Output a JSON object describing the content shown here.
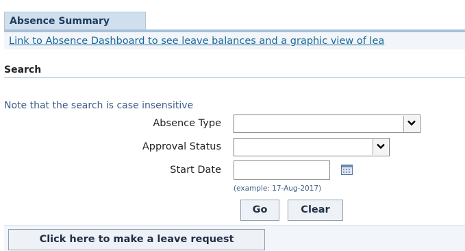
{
  "tab": {
    "label": "Absence Summary"
  },
  "dashboard_link": {
    "text": "Link to Absence Dashboard to see leave balances and a graphic view of lea"
  },
  "search": {
    "header": "Search",
    "note": "Note that the search is case insensitive",
    "fields": {
      "absence_type": {
        "label": "Absence Type",
        "value": ""
      },
      "approval_status": {
        "label": "Approval Status",
        "value": ""
      },
      "start_date": {
        "label": "Start Date",
        "value": "",
        "hint": "(example: 17-Aug-2017)"
      }
    },
    "go_label": "Go",
    "clear_label": "Clear"
  },
  "leave_request": {
    "label": "Click here to make a leave request"
  },
  "icons": {
    "dropdown": "chevron-down-icon",
    "calendar": "calendar-icon"
  },
  "colors": {
    "tab_bg": "#d0dfed",
    "link": "#1a6898",
    "note": "#3d5e86"
  }
}
